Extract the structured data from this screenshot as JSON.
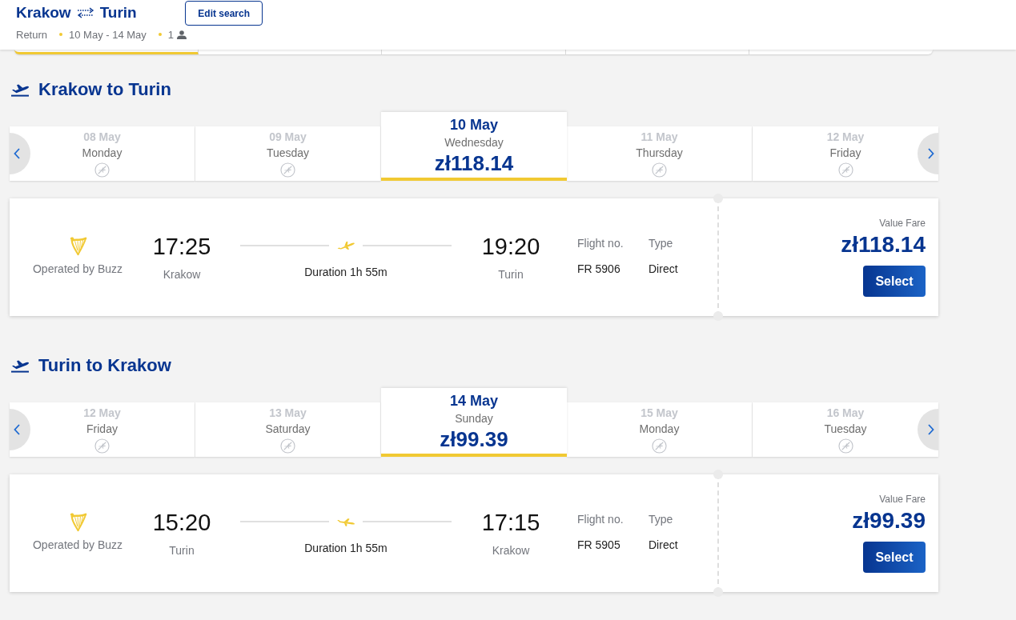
{
  "header": {
    "origin": "Krakow",
    "destination": "Turin",
    "edit_button": "Edit search",
    "trip_type": "Return",
    "dates": "10 May - 14 May",
    "passengers": "1"
  },
  "top_strip": [
    {
      "selected": true
    },
    {
      "selected": false
    },
    {
      "selected": false
    },
    {
      "selected": false
    },
    {
      "selected": false
    }
  ],
  "legs": [
    {
      "kind": "outbound",
      "title": "Krakow to Turin",
      "dates": [
        {
          "date": "08 May",
          "day": "Monday",
          "available": false,
          "selected": false
        },
        {
          "date": "09 May",
          "day": "Tuesday",
          "available": false,
          "selected": false
        },
        {
          "date": "10 May",
          "day": "Wednesday",
          "available": true,
          "price": "zł118.14",
          "selected": true
        },
        {
          "date": "11 May",
          "day": "Thursday",
          "available": false,
          "selected": false
        },
        {
          "date": "12 May",
          "day": "Friday",
          "available": false,
          "selected": false
        }
      ],
      "flight": {
        "operator": "Operated by Buzz",
        "departure_time": "17:25",
        "departure_city": "Krakow",
        "duration": "Duration 1h 55m",
        "arrival_time": "19:20",
        "arrival_city": "Turin",
        "flight_no_label": "Flight no.",
        "flight_no": "FR 5906",
        "type_label": "Type",
        "type": "Direct",
        "fare_name": "Value Fare",
        "price": "zł118.14",
        "button": "Select"
      }
    },
    {
      "kind": "return",
      "title": "Turin to Krakow",
      "dates": [
        {
          "date": "12 May",
          "day": "Friday",
          "available": false,
          "selected": false
        },
        {
          "date": "13 May",
          "day": "Saturday",
          "available": false,
          "selected": false
        },
        {
          "date": "14 May",
          "day": "Sunday",
          "available": true,
          "price": "zł99.39",
          "selected": true
        },
        {
          "date": "15 May",
          "day": "Monday",
          "available": false,
          "selected": false
        },
        {
          "date": "16 May",
          "day": "Tuesday",
          "available": false,
          "selected": false
        }
      ],
      "flight": {
        "operator": "Operated by Buzz",
        "departure_time": "15:20",
        "departure_city": "Turin",
        "duration": "Duration 1h 55m",
        "arrival_time": "17:15",
        "arrival_city": "Krakow",
        "flight_no_label": "Flight no.",
        "flight_no": "FR 5905",
        "type_label": "Type",
        "type": "Direct",
        "fare_name": "Value Fare",
        "price": "zł99.39",
        "button": "Select"
      }
    }
  ]
}
